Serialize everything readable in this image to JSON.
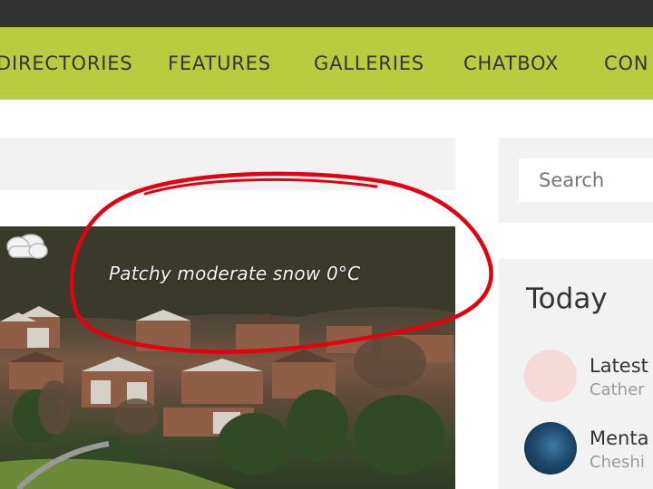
{
  "nav": {
    "items": [
      {
        "label": "DIRECTORIES"
      },
      {
        "label": "FEATURES"
      },
      {
        "label": "GALLERIES"
      },
      {
        "label": "CHATBOX"
      },
      {
        "label": "CON"
      }
    ]
  },
  "hero": {
    "weather_text": "Patchy moderate snow 0°C",
    "weather_icon": "cloud-icon"
  },
  "sidebar": {
    "search_placeholder": "Search",
    "today": {
      "heading": "Today",
      "posts": [
        {
          "title": "Latest",
          "meta": "Cather",
          "thumb_color": "#f6d9d9"
        },
        {
          "title": "Menta",
          "meta": "Cheshi",
          "thumb_color": "#1e4a6e"
        }
      ]
    }
  },
  "colors": {
    "nav_bg": "#b9cc3f",
    "topbar_bg": "#333333",
    "annotation": "#e3000f"
  }
}
